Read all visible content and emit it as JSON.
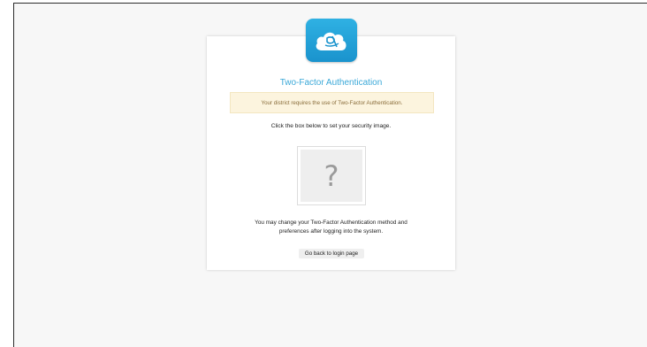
{
  "page": {
    "title": "Two-Factor Authentication",
    "notice": "Your district requires the use of Two-Factor Authentication.",
    "instruction": "Click the box below to set your security image.",
    "security_image_placeholder": "?",
    "change_note_line1": "You may change your Two-Factor Authentication method and",
    "change_note_line2": "preferences after logging into the system.",
    "back_button_label": "Go back to login page"
  },
  "logo": {
    "icon": "cloud-logo-icon"
  },
  "colors": {
    "accent": "#3aa8d8",
    "logo_bg": "#1fa2d9",
    "notice_bg": "#fcf4de",
    "notice_text": "#8a6d3b",
    "page_bg": "#f7f7f7"
  }
}
